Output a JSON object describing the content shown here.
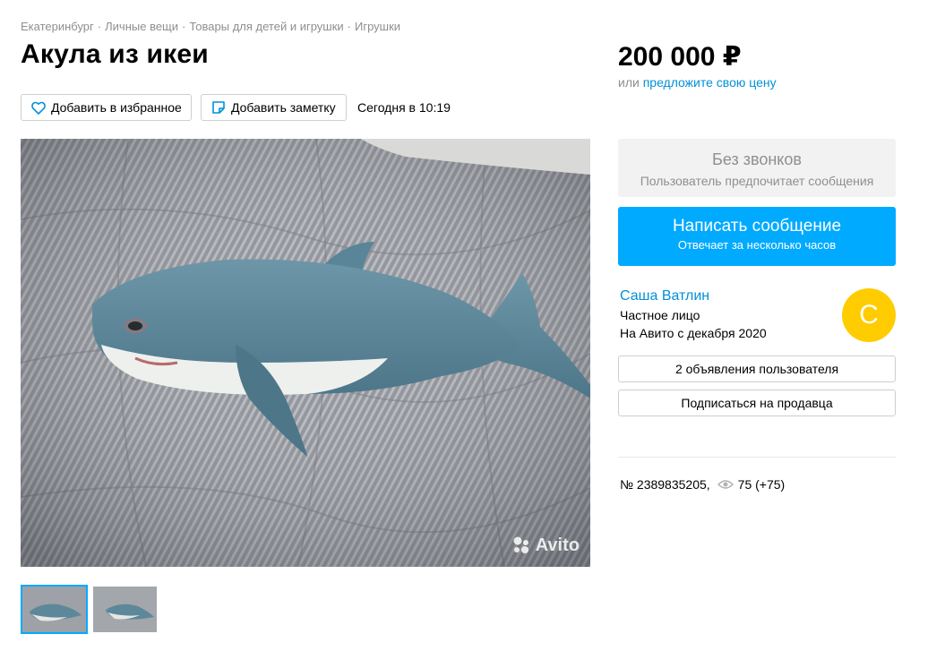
{
  "breadcrumbs": [
    "Екатеринбург",
    "Личные вещи",
    "Товары для детей и игрушки",
    "Игрушки"
  ],
  "title": "Акула из икеи",
  "actions": {
    "favorite_label": "Добавить в избранное",
    "note_label": "Добавить заметку",
    "date": "Сегодня в 10:19"
  },
  "gallery": {
    "watermark": "Avito",
    "thumbnails_count": 2,
    "active_thumbnail": 1
  },
  "price": {
    "value": "200 000 ₽",
    "or_text": "или",
    "offer_link": "предложите свою цену"
  },
  "contact": {
    "no_calls_title": "Без звонков",
    "no_calls_sub": "Пользователь предпочитает сообщения",
    "message_title": "Написать сообщение",
    "message_sub": "Отвечает за несколько часов"
  },
  "seller": {
    "name": "Саша Ватлин",
    "type": "Частное лицо",
    "since": "На Авито с декабря 2020",
    "avatar_letter": "С",
    "ads_button": "2 объявления пользователя",
    "subscribe_button": "Подписаться на продавца"
  },
  "meta": {
    "ad_number": "№ 2389835205,",
    "views": "75 (+75)"
  },
  "colors": {
    "accent": "#00aaff",
    "link": "#0091d9",
    "avatar": "#ffcc00",
    "muted": "#8f8f8f"
  },
  "icons": [
    "heart-icon",
    "note-icon",
    "avito-logo-icon",
    "eye-icon"
  ]
}
